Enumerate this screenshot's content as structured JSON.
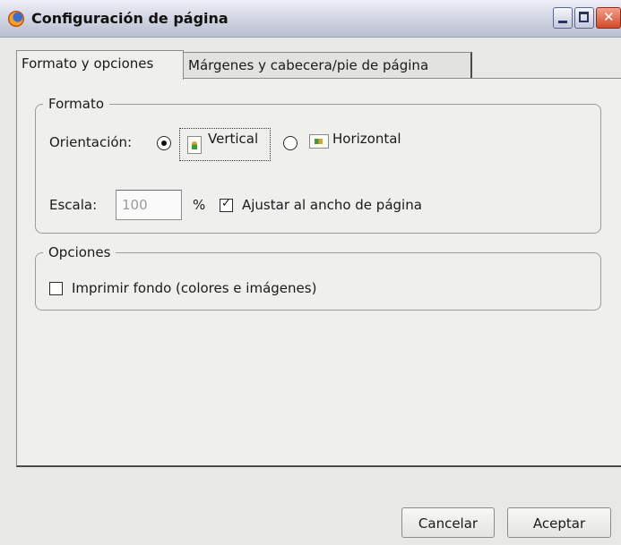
{
  "window": {
    "title": "Configuración de página",
    "app_icon": "firefox-icon",
    "controls": [
      "minimize-icon",
      "maximize-icon",
      "close-icon"
    ]
  },
  "tabs": [
    {
      "label": "Formato y opciones",
      "active": true
    },
    {
      "label": "Márgenes y cabecera/pie de página",
      "active": false
    }
  ],
  "formato": {
    "legend": "Formato",
    "orientation_label": "Orientación:",
    "vertical_label": "Vertical",
    "horizontal_label": "Horizontal",
    "selected": "Vertical",
    "scale_label": "Escala:",
    "scale_value": "100",
    "percent_label": "%",
    "fit_label": "Ajustar al ancho de página",
    "fit_checked": true
  },
  "opciones": {
    "legend": "Opciones",
    "print_bg_label": "Imprimir fondo (colores e imágenes)",
    "print_bg_checked": false
  },
  "buttons": {
    "cancel": "Cancelar",
    "ok": "Aceptar"
  }
}
